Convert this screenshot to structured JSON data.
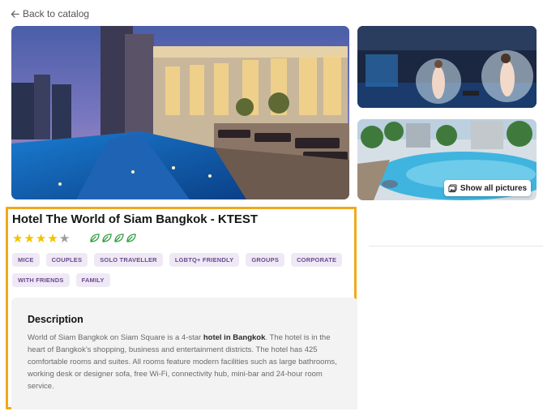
{
  "nav": {
    "back_label": "Back to catalog"
  },
  "gallery": {
    "show_all_label": "Show all pictures",
    "photos": [
      {
        "subject": "rooftop-pool-night"
      },
      {
        "subject": "lounge-bubble-chairs"
      },
      {
        "subject": "outdoor-pool-day"
      }
    ]
  },
  "hotel": {
    "name": "Hotel The World of Siam Bangkok - KTEST",
    "star_rating": 4,
    "star_max": 5,
    "eco_leaves": 4,
    "tags": [
      "MICE",
      "COUPLES",
      "SOLO TRAVELLER",
      "LGBTQ+ FRIENDLY",
      "GROUPS",
      "CORPORATE",
      "WITH FRIENDS",
      "FAMILY"
    ]
  },
  "description": {
    "heading": "Description",
    "text_before": "World of Siam Bangkok on Siam Square is a 4-star ",
    "text_bold": "hotel in Bangkok",
    "text_after": ". The hotel is in the heart of Bangkok's shopping, business and entertainment districts. The hotel has 425 comfortable rooms and suites. All rooms feature modern facilities such as large bathrooms, working desk or designer sofa, free Wi-Fi, connectivity hub, mini-bar and 24-hour room service."
  },
  "colors": {
    "highlight_border": "#efaa1a",
    "star_filled": "#f2c200",
    "star_empty": "#9d9d9d",
    "leaf": "#2f9e3f",
    "tag_background": "#efe9f6",
    "tag_text": "#6a4a8c"
  }
}
